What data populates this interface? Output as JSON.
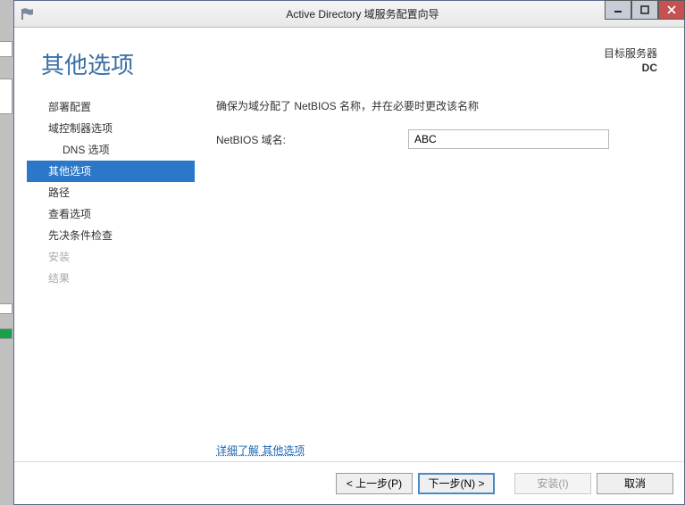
{
  "window": {
    "title": "Active Directory 域服务配置向导"
  },
  "header": {
    "page_title": "其他选项",
    "target_label": "目标服务器",
    "target_value": "DC"
  },
  "sidebar": {
    "items": [
      {
        "label": "部署配置"
      },
      {
        "label": "域控制器选项"
      },
      {
        "label": "DNS 选项"
      },
      {
        "label": "其他选项"
      },
      {
        "label": "路径"
      },
      {
        "label": "查看选项"
      },
      {
        "label": "先决条件检查"
      },
      {
        "label": "安装"
      },
      {
        "label": "结果"
      }
    ]
  },
  "content": {
    "instruction": "确保为域分配了 NetBIOS 名称，并在必要时更改该名称",
    "netbios_label": "NetBIOS 域名:",
    "netbios_value": "ABC",
    "more_prefix": "详细了解",
    "more_link": "其他选项"
  },
  "footer": {
    "prev": "< 上一步(P)",
    "next": "下一步(N) >",
    "install": "安装(I)",
    "cancel": "取消"
  }
}
